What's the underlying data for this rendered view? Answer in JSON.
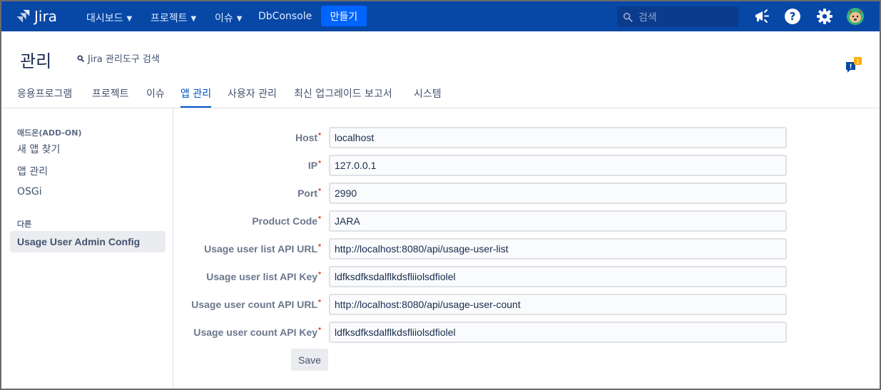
{
  "topnav": {
    "logo_text": "Jira",
    "items": [
      {
        "label": "대시보드"
      },
      {
        "label": "프로젝트"
      },
      {
        "label": "이슈"
      },
      {
        "label": "DbConsole"
      }
    ],
    "create_label": "만들기",
    "search_placeholder": "검색",
    "icons": [
      "megaphone-icon",
      "help-icon",
      "settings-icon",
      "avatar-icon"
    ],
    "colors": {
      "bar": "#0747a6",
      "create": "#0065ff"
    }
  },
  "admin": {
    "title": "관리",
    "search_label": "Jira 관리도구 검색",
    "feedback_badge": "1",
    "tabs": [
      {
        "label": "응용프로그램"
      },
      {
        "label": "프로젝트"
      },
      {
        "label": "이슈"
      },
      {
        "label": "앱 관리"
      },
      {
        "label": "사용자 관리"
      },
      {
        "label": "최신 업그레이드 보고서"
      },
      {
        "label": "시스템"
      }
    ],
    "active_tab": "앱 관리"
  },
  "sidebar": {
    "section1_heading": "애드온(ADD-ON)",
    "section1_items": [
      {
        "label": "새 앱 찾기"
      },
      {
        "label": "앱 관리"
      },
      {
        "label": "OSGi"
      }
    ],
    "section2_heading": "다른",
    "section2_items": [
      {
        "label": "Usage User Admin Config"
      }
    ]
  },
  "form": {
    "required_mark": "*",
    "fields": [
      {
        "label": "Host",
        "value": "localhost"
      },
      {
        "label": "IP",
        "value": "127.0.0.1"
      },
      {
        "label": "Port",
        "value": "2990"
      },
      {
        "label": "Product Code",
        "value": "JARA"
      },
      {
        "label": "Usage user list API URL",
        "value": "http://localhost:8080/api/usage-user-list"
      },
      {
        "label": "Usage user list API Key",
        "value": "ldfksdfksdalflkdsfliiolsdfiolel"
      },
      {
        "label": "Usage user count API URL",
        "value": "http://localhost:8080/api/usage-user-count"
      },
      {
        "label": "Usage user count API Key",
        "value": "ldfksdfksdalflkdsfliiolsdfiolel"
      }
    ],
    "save_label": "Save"
  }
}
